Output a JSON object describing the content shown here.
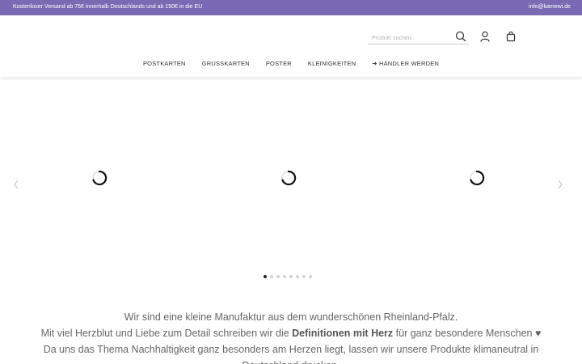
{
  "topbar": {
    "shipping_text": "Kostenloser Versand ab 75€ innerhalb Deutschlands und ab 150€ in die EU",
    "email": "info@kamewi.de",
    "background_color": "#7b69b3"
  },
  "header": {
    "search": {
      "placeholder": "Produkt suchen",
      "icon": "search-icon"
    },
    "icons": [
      "user-icon",
      "bag-icon"
    ],
    "nav": [
      {
        "label": "POSTKARTEN"
      },
      {
        "label": "GRUSSKARTEN"
      },
      {
        "label": "POSTER"
      },
      {
        "label": "KLEINIGKEITEN"
      },
      {
        "label": "➜ HÄNDLER WERDEN"
      }
    ]
  },
  "slider": {
    "prev_icon": "chevron-left-icon",
    "next_icon": "chevron-right-icon",
    "loading_icon": "loading-spinner-icon",
    "slides_visible": 3,
    "dot_count": 8,
    "active_dot": 1
  },
  "intro": {
    "line1": "Wir sind eine kleine Manufaktur aus dem wunderschönen Rheinland-Pfalz.",
    "line2_before": "Mit viel Herzblut und Liebe zum Detail schreiben wir die ",
    "line2_bold": "Definitionen mit Herz",
    "line2_after": " für ganz besondere Menschen ♥",
    "line3": "Da uns das Thema Nachhaltigkeit ganz besonders am Herzen liegt, lassen wir unsere Produkte klimaneutral in",
    "line4": "Deutschland drucken."
  }
}
